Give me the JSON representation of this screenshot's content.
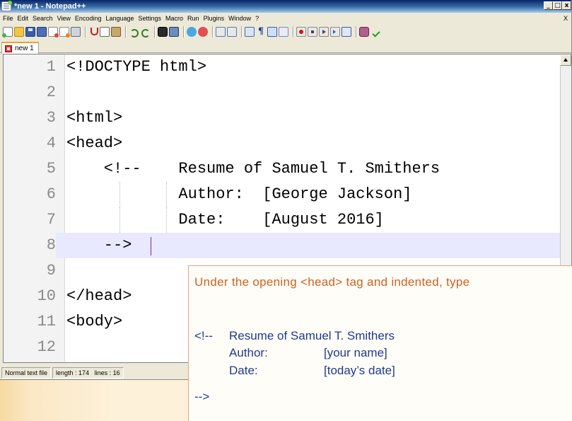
{
  "window": {
    "title": "*new 1 - Notepad++",
    "min_btn": "_",
    "max_btn": "□",
    "close_btn": "x"
  },
  "menu": {
    "items": [
      "File",
      "Edit",
      "Search",
      "View",
      "Encoding",
      "Language",
      "Settings",
      "Macro",
      "Run",
      "Plugins",
      "Window",
      "?"
    ],
    "close_doc": "X"
  },
  "toolbar": {
    "icons": [
      "new-file-icon",
      "open-file-icon",
      "save-icon",
      "save-all-icon",
      "close-icon",
      "close-all-icon",
      "print-icon",
      "cut-icon",
      "copy-icon",
      "paste-icon",
      "undo-icon",
      "redo-icon",
      "find-icon",
      "replace-icon",
      "zoom-in-icon",
      "zoom-out-icon",
      "sync-vertical-icon",
      "sync-horizontal-icon",
      "word-wrap-icon",
      "show-all-characters-icon",
      "indent-guide-icon",
      "fold-icon",
      "record-macro-icon",
      "stop-macro-icon",
      "play-macro-icon",
      "run-macro-multiple-icon",
      "save-macro-icon",
      "launch-icon",
      "spell-check-icon"
    ]
  },
  "tab": {
    "label": "new 1"
  },
  "editor": {
    "lines": [
      {
        "num": "1",
        "text": "<!DOCTYPE html>"
      },
      {
        "num": "2",
        "text": ""
      },
      {
        "num": "3",
        "text": "<html>"
      },
      {
        "num": "4",
        "text": "<head>"
      },
      {
        "num": "5",
        "text": "    <!--    Resume of Samuel T. Smithers"
      },
      {
        "num": "6",
        "text": "            Author:  [George Jackson]"
      },
      {
        "num": "7",
        "text": "            Date:    [August 2016]"
      },
      {
        "num": "8",
        "text": "    -->"
      },
      {
        "num": "9",
        "text": ""
      },
      {
        "num": "10",
        "text": "</head>"
      },
      {
        "num": "11",
        "text": "<body>"
      },
      {
        "num": "12",
        "text": ""
      }
    ],
    "current_line": "8"
  },
  "status": {
    "file_type": "Normal text file",
    "length": "length : 174",
    "lines": "lines : 16"
  },
  "callout": {
    "instruction": "Under the opening <head> tag and indented, type",
    "comment_open": "<!--",
    "resume_text": "Resume of Samuel T. Smithers",
    "author_label": "Author:",
    "author_value": "[your name]",
    "date_label": "Date:",
    "date_value": "[today’s date]",
    "comment_close": "-->"
  },
  "colors": {
    "instruction_text": "#d0621e",
    "code_text": "#1f3a8f",
    "current_line_bg": "#e8e8ff",
    "title_bar": "#0a246a"
  }
}
